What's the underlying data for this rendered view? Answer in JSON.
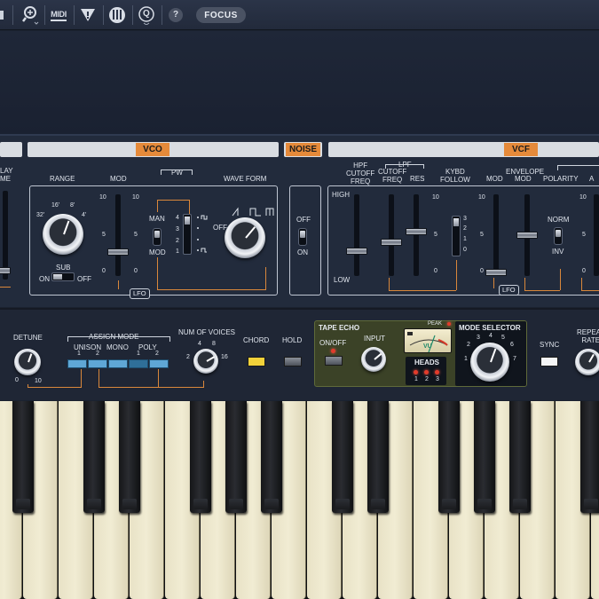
{
  "toolbar": {
    "icons": [
      "settings-icon",
      "zoom-icon",
      "midi-icon",
      "funnel-icon",
      "keyboard-icon",
      "quantize-icon",
      "help-icon"
    ],
    "midi_label": "MIDI",
    "q_label": "Q",
    "help_label": "?",
    "focus_label": "FOCUS"
  },
  "sections": {
    "vco": "VCO",
    "noise": "NOISE",
    "vcf": "VCF"
  },
  "delay": {
    "line1": "LAY",
    "line2": "ME"
  },
  "vco": {
    "range_label": "RANGE",
    "range_marks": [
      "32'",
      "16'",
      "8'",
      "4'"
    ],
    "mod_label": "MOD",
    "mod_ticks": [
      "10",
      "5",
      "0"
    ],
    "mod_ticks_right": [
      "10",
      "5",
      "0"
    ],
    "pw_label": "PW",
    "pw_man": "MAN",
    "pw_mod": "MOD",
    "wave_label": "WAVE FORM",
    "wave_off": "OFF",
    "wave_steps": [
      "4",
      "3",
      "2",
      "1"
    ],
    "sub_label": "SUB",
    "sub_on": "ON",
    "sub_off": "OFF",
    "lfo": "LFO"
  },
  "noise": {
    "off": "OFF",
    "on": "ON"
  },
  "vcf": {
    "hpf_label": "HPF\nCUTOFF\nFREQ",
    "lpf_label": "LPF",
    "lpf_cutoff": "CUTOFF\nFREQ",
    "res": "RES",
    "kybd": "KYBD\nFOLLOW",
    "mod": "MOD",
    "envelope": "ENVELOPE",
    "env_mod": "MOD",
    "polarity": "POLARITY",
    "a": "A",
    "high": "HIGH",
    "low": "LOW",
    "ticks": [
      "10",
      "5",
      "0"
    ],
    "kybd_steps": [
      "3",
      "2",
      "1",
      "0"
    ],
    "norm": "NORM",
    "inv": "INV",
    "lfo": "LFO"
  },
  "lower": {
    "detune": "DETUNE",
    "detune_min": "0",
    "detune_max": "10",
    "assign_mode": "ASSIGN MODE",
    "unison": "UNISON",
    "mono": "MONO",
    "poly": "POLY",
    "unison_nums": [
      "1",
      "2"
    ],
    "poly_nums": [
      "1",
      "2"
    ],
    "num_voices": "NUM OF VOICES",
    "voices_marks": [
      "2",
      "4",
      "8",
      "16"
    ],
    "chord": "CHORD",
    "hold": "HOLD",
    "tape_echo": "TAPE ECHO",
    "on_off": "ON/OFF",
    "input": "INPUT",
    "peak": "PEAK",
    "vu": "VU",
    "heads": "HEADS",
    "heads_nums": [
      "1",
      "2",
      "3"
    ],
    "mode_selector": "MODE SELECTOR",
    "mode_marks": [
      "1",
      "2",
      "3",
      "4",
      "5",
      "6",
      "7"
    ],
    "sync": "SYNC",
    "repeat_rate": "REPEAT\nRATE"
  },
  "colors": {
    "accent_orange": "#e58a3a",
    "assign_blue": "#5fa7d6",
    "chord_yellow": "#f2d23a",
    "key_ivory": "#efe9cf",
    "tape_green": "#3b4227"
  }
}
